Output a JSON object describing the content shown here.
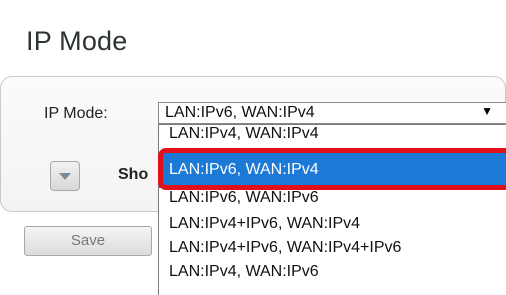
{
  "page": {
    "title": "IP Mode"
  },
  "form": {
    "ip_mode_label": "IP Mode:",
    "ip_mode_value": "LAN:IPv6, WAN:IPv4",
    "dropdown_arrow": "▼",
    "show_label": "Sho",
    "save_label": "Save"
  },
  "dropdown": {
    "options": [
      "LAN:IPv4, WAN:IPv4",
      "LAN:IPv6, WAN:IPv4",
      "LAN:IPv6, WAN:IPv6",
      "LAN:IPv4+IPv6, WAN:IPv4",
      "LAN:IPv4+IPv6, WAN:IPv4+IPv6",
      "LAN:IPv4, WAN:IPv6"
    ],
    "selected_index": 1
  },
  "colors": {
    "selection": "#1c79d6",
    "highlight_border": "#e0111b"
  }
}
